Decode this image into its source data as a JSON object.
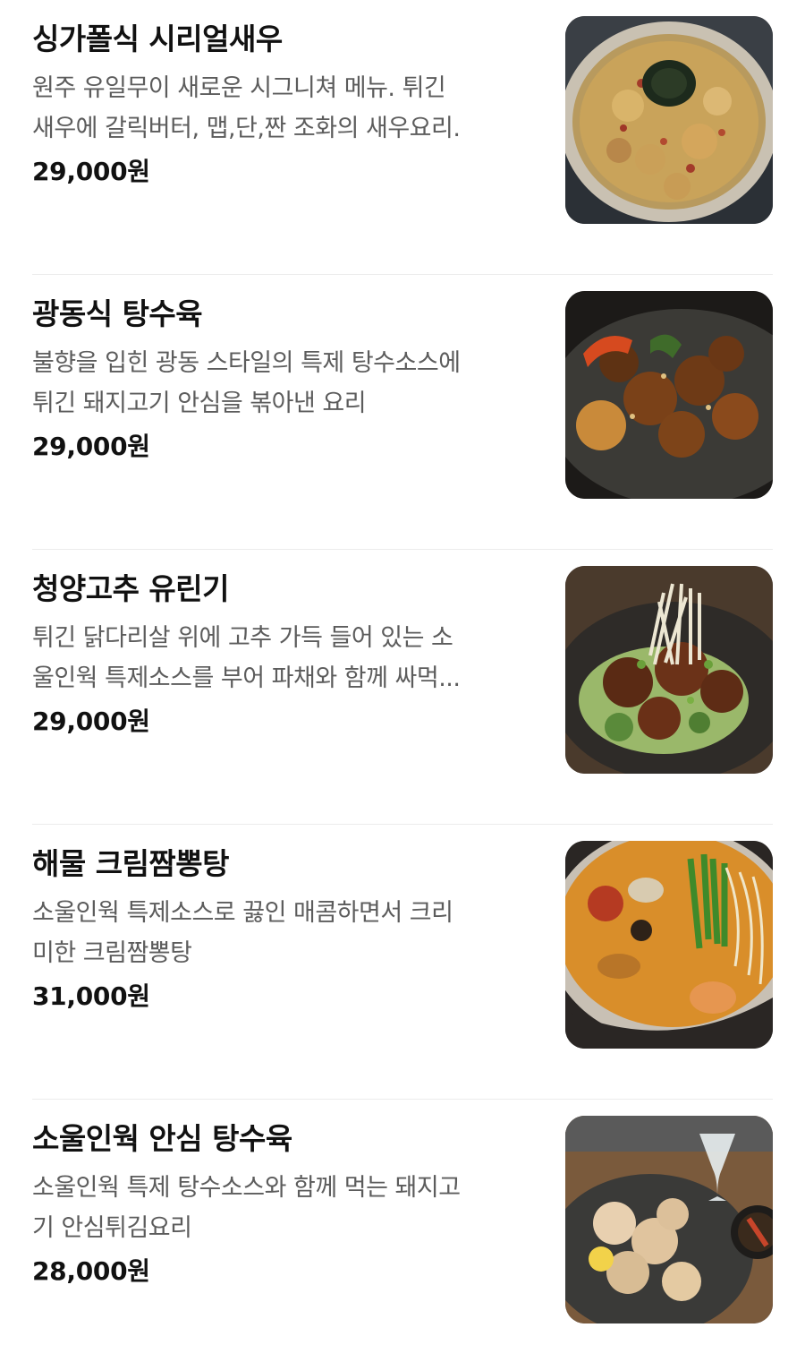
{
  "menu": {
    "items": [
      {
        "name": "싱가폴식 시리얼새우",
        "desc_lines": [
          "원주 유일무이 새로운 시그니쳐 메뉴. 튀긴",
          "새우에 갈릭버터, 맵,단,짠 조화의 새우요리."
        ],
        "price": "29,000원",
        "image": "cereal-shrimp-photo"
      },
      {
        "name": "광동식 탕수육",
        "desc_lines": [
          "불향을 입힌 광동 스타일의 특제 탕수소스에",
          "튀긴 돼지고기 안심을 볶아낸 요리"
        ],
        "price": "29,000원",
        "image": "cantonese-sweet-sour-pork-photo"
      },
      {
        "name": "청양고추 유린기",
        "desc_lines": [
          "튀긴 닭다리살 위에 고추 가득 들어 있는 소",
          "울인웍 특제소스를 부어 파채와 함께 싸먹..."
        ],
        "price": "29,000원",
        "image": "chili-yuringi-photo"
      },
      {
        "name": "해물 크림짬뽕탕",
        "desc_lines": [
          "소울인웍 특제소스로 끓인 매콤하면서 크리",
          "미한 크림짬뽕탕"
        ],
        "price": "31,000원",
        "image": "seafood-cream-jjamppong-photo"
      },
      {
        "name": "소울인웍 안심 탕수육",
        "desc_lines": [
          "소울인웍 특제 탕수소스와 함께 먹는 돼지고",
          "기 안심튀김요리"
        ],
        "price": "28,000원",
        "image": "tenderloin-sweet-sour-pork-photo"
      }
    ]
  }
}
